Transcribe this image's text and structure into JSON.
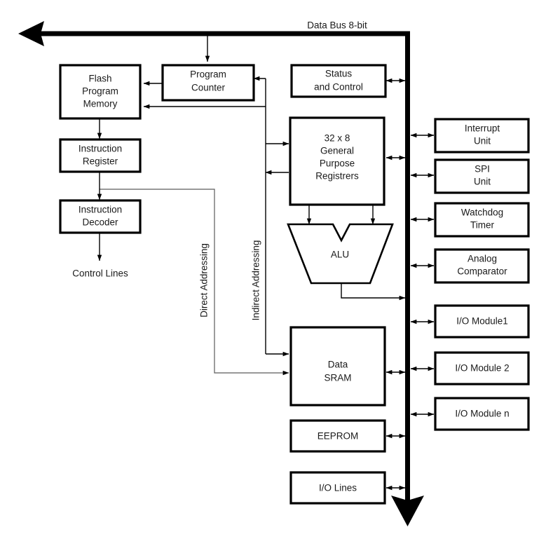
{
  "diagram": {
    "title": "Data Bus 8-bit",
    "bus_label": "Data Bus 8-bit",
    "accent_color": "#000000",
    "background_color": "#ffffff",
    "blocks": {
      "flash_program_memory": {
        "line1": "Flash",
        "line2": "Program",
        "line3": "Memory"
      },
      "program_counter": {
        "line1": "Program",
        "line2": "Counter"
      },
      "status_and_control": {
        "line1": "Status",
        "line2": "and Control"
      },
      "instruction_register": {
        "line1": "Instruction",
        "line2": "Register"
      },
      "instruction_decoder": {
        "line1": "Instruction",
        "line2": "Decoder"
      },
      "general_purpose_registers": {
        "line1": "32 x 8",
        "line2": "General",
        "line3": "Purpose",
        "line4": "Registrers"
      },
      "alu": {
        "line1": "ALU"
      },
      "data_sram": {
        "line1": "Data",
        "line2": "SRAM"
      },
      "eeprom": {
        "line1": "EEPROM"
      },
      "io_lines": {
        "line1": "I/O Lines"
      },
      "interrupt_unit": {
        "line1": "Interrupt",
        "line2": "Unit"
      },
      "spi_unit": {
        "line1": "SPI",
        "line2": "Unit"
      },
      "watchdog_timer": {
        "line1": "Watchdog",
        "line2": "Timer"
      },
      "analog_comparator": {
        "line1": "Analog",
        "line2": "Comparator"
      },
      "io_module_1": {
        "line1": "I/O Module1"
      },
      "io_module_2": {
        "line1": "I/O Module 2"
      },
      "io_module_n": {
        "line1": "I/O Module n"
      }
    },
    "free_text": {
      "control_lines": "Control Lines",
      "direct_addressing": "Direct Addressing",
      "indirect_addressing": "Indirect Addressing"
    }
  }
}
